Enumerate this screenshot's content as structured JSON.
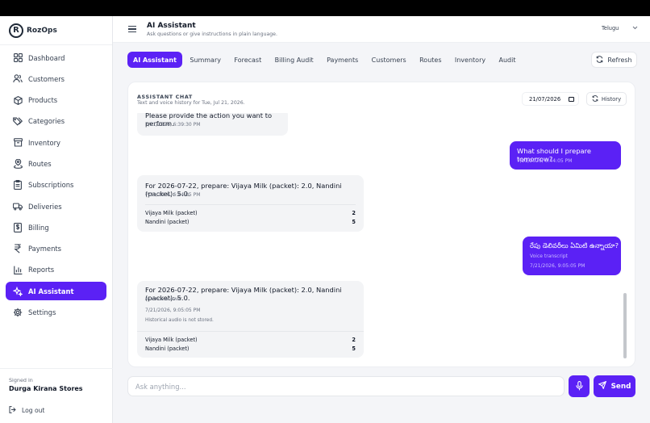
{
  "brand": {
    "name": "RozOps",
    "logo_letter": "R"
  },
  "sidebar": {
    "items": [
      {
        "label": "Dashboard",
        "icon": "grid-icon"
      },
      {
        "label": "Customers",
        "icon": "users-icon"
      },
      {
        "label": "Products",
        "icon": "box-icon"
      },
      {
        "label": "Categories",
        "icon": "tags-icon"
      },
      {
        "label": "Inventory",
        "icon": "archive-icon"
      },
      {
        "label": "Routes",
        "icon": "map-pin-icon"
      },
      {
        "label": "Subscriptions",
        "icon": "clipboard-icon"
      },
      {
        "label": "Deliveries",
        "icon": "truck-icon"
      },
      {
        "label": "Billing",
        "icon": "receipt-icon"
      },
      {
        "label": "Payments",
        "icon": "rupee-icon"
      },
      {
        "label": "Reports",
        "icon": "bar-chart-icon"
      },
      {
        "label": "AI Assistant",
        "icon": "sparkles-icon",
        "active": true
      },
      {
        "label": "Settings",
        "icon": "gear-icon"
      }
    ],
    "signed_in_label": "Signed in",
    "store_name": "Durga Kirana Stores",
    "logout_label": "Log out"
  },
  "header": {
    "title": "AI Assistant",
    "subtitle": "Ask questions or give instructions in plain language.",
    "language": "Telugu"
  },
  "tabs": [
    "AI Assistant",
    "Summary",
    "Forecast",
    "Billing Audit",
    "Payments",
    "Customers",
    "Routes",
    "Inventory",
    "Audit"
  ],
  "active_tab": "AI Assistant",
  "refresh_label": "Refresh",
  "chat_card": {
    "title": "ASSISTANT CHAT",
    "subtitle": "Text and voice history for Tue, Jul 21, 2026.",
    "date_value": "21/07/2026",
    "history_label": "History"
  },
  "messages": [
    {
      "side": "in",
      "text": "Please provide the action you want to perform.",
      "time": "7/21/2026, 6:39:30 PM"
    },
    {
      "side": "out",
      "text": "What should I prepare tomorrow?",
      "time": "7/21/2026, 6:44:05 PM"
    },
    {
      "side": "in",
      "text": "For 2026-07-22, prepare: Vijaya Milk (packet): 2.0, Nandini (packet): 5.0.",
      "time": "7/21/2026, 6:44:05 PM",
      "items": [
        {
          "name": "Vijaya Milk (packet)",
          "qty": "2"
        },
        {
          "name": "Nandini (packet)",
          "qty": "5"
        }
      ]
    },
    {
      "side": "out",
      "text": "రేపు డెలివరీలు ఏమిటి ఉన్నాయా?",
      "note": "Voice transcript",
      "time": "7/21/2026, 9:05:05 PM"
    },
    {
      "side": "in",
      "text": "For 2026-07-22, prepare: Vijaya Milk (packet): 2.0, Nandini (packet): 5.0.",
      "note": "AI voice answer",
      "time": "7/21/2026, 9:05:05 PM",
      "extra": "Historical audio is not stored.",
      "items": [
        {
          "name": "Vijaya Milk (packet)",
          "qty": "2"
        },
        {
          "name": "Nandini (packet)",
          "qty": "5"
        }
      ]
    }
  ],
  "composer": {
    "placeholder": "Ask anything...",
    "send_label": "Send"
  },
  "colors": {
    "accent": "#5b21f5",
    "bg": "#f4f5f8",
    "bubble": "#f3f4f6"
  }
}
